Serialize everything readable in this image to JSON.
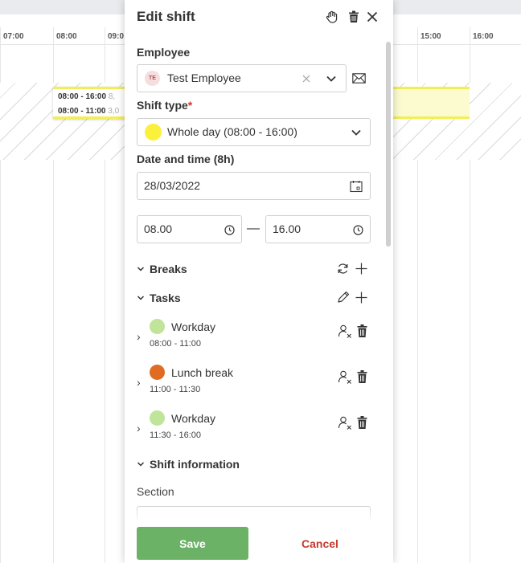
{
  "schedule": {
    "hours": [
      "07:00",
      "08:00",
      "09:0",
      "15:00",
      "16:00"
    ],
    "shift_block": {
      "line1": "08:00 - 16:00",
      "line1_extra": "8,",
      "line2": "08:00 - 11:00",
      "line2_extra": "3,0"
    },
    "shift_color": "#f2ee58"
  },
  "modal": {
    "title": "Edit shift",
    "header_icons": [
      "hand-icon",
      "trash-icon",
      "close-icon"
    ],
    "employee": {
      "label": "Employee",
      "avatar_initials": "TE",
      "value": "Test Employee"
    },
    "shift_type": {
      "label": "Shift type",
      "required_mark": "*",
      "value": "Whole day  (08:00 - 16:00)",
      "color": "#fbf03c"
    },
    "date_time": {
      "label": "Date and time (8h)",
      "date": "28/03/2022",
      "start": "08.00",
      "separator": "—",
      "end": "16.00"
    },
    "breaks": {
      "label": "Breaks"
    },
    "tasks": {
      "label": "Tasks",
      "items": [
        {
          "name": "Workday",
          "time": "08:00 - 11:00",
          "color": "#bfe49a"
        },
        {
          "name": "Lunch break",
          "time": "11:00 - 11:30",
          "color": "#e06b22"
        },
        {
          "name": "Workday",
          "time": "11:30 - 16:00",
          "color": "#bfe49a"
        }
      ]
    },
    "shift_information": {
      "label": "Shift information",
      "section_label": "Section"
    },
    "save_label": "Save",
    "cancel_label": "Cancel",
    "colors": {
      "save": "#6bb266",
      "cancel": "#c93a2e",
      "required": "#d9342b"
    }
  }
}
